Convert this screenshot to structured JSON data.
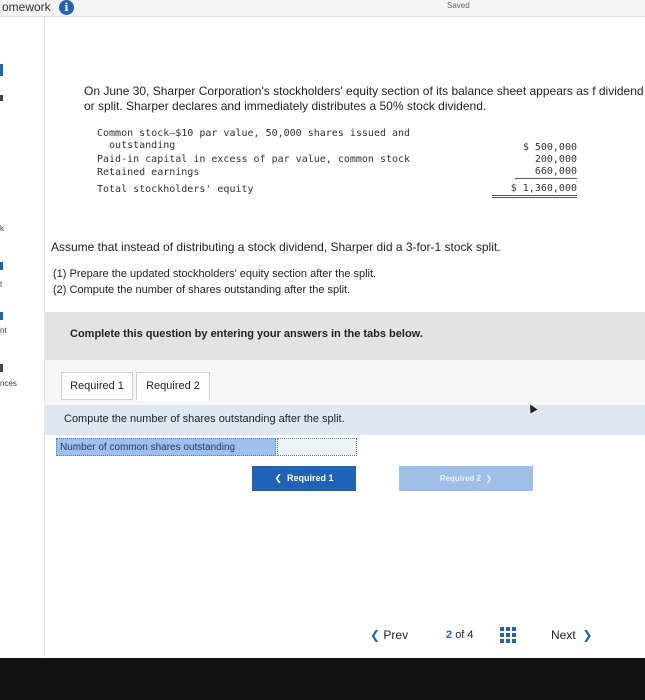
{
  "header": {
    "title": "omework",
    "saved": "Saved"
  },
  "sidebar": {
    "items": [
      "k",
      "t",
      "nt",
      "nces"
    ]
  },
  "problem": {
    "text": "On June 30, Sharper Corporation's stockholders' equity section of its balance sheet appears as f dividend or split. Sharper declares and immediately distributes a 50% stock dividend.",
    "equity_rows": [
      {
        "label": "Common stock—$10 par value, 50,000 shares issued and",
        "value": ""
      },
      {
        "label": "  outstanding",
        "value": "$ 500,000"
      },
      {
        "label": "Paid-in capital in excess of par value, common stock",
        "value": "200,000"
      },
      {
        "label": "Retained earnings",
        "value": "660,000"
      },
      {
        "label": "Total stockholders' equity",
        "value": "$ 1,360,000"
      }
    ],
    "assume": "Assume that instead of distributing a stock dividend, Sharper did a 3-for-1 stock split.",
    "requirements": [
      "(1) Prepare the updated stockholders' equity section after the split.",
      "(2) Compute the number of shares outstanding after the split."
    ]
  },
  "instructions": "Complete this question by entering your answers in the tabs below.",
  "tabs": [
    "Required 1",
    "Required 2"
  ],
  "active_tab": "Required 2",
  "question": "Compute the number of shares outstanding after the split.",
  "answer": {
    "label": "Number of common shares outstanding",
    "value": ""
  },
  "buttons": {
    "prev_req": "Required 1",
    "next_req": "Required 2"
  },
  "pager": {
    "prev": "Prev",
    "current": "2",
    "of": "of 4",
    "next": "Next"
  }
}
